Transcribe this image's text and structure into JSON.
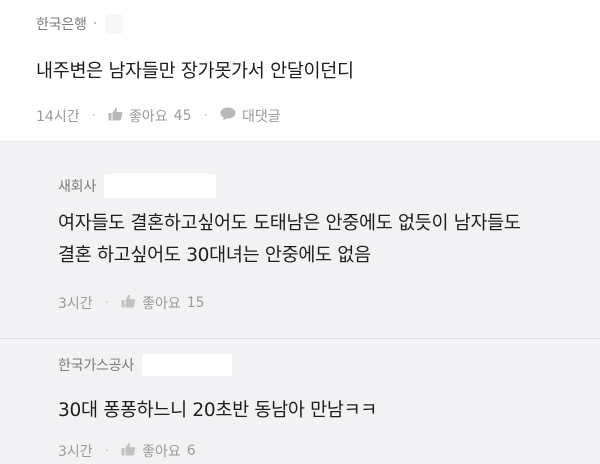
{
  "comments": [
    {
      "author": "한국은행",
      "text": "내주변은 남자들만 장가못가서 안달이던디",
      "time": "14시간",
      "like_label": "좋아요",
      "like_count": "45",
      "reply_label": "대댓글"
    },
    {
      "author": "새회사",
      "text_line1": "여자들도 결혼하고싶어도 도태남은 안중에도 없듯이 남자들도",
      "text_line2": "결혼 하고싶어도 30대녀는 안중에도 없음",
      "time": "3시간",
      "like_label": "좋아요",
      "like_count": "15"
    },
    {
      "author": "한국가스공사",
      "text": "30대 퐁퐁하느니 20초반 동남아 만남ㅋㅋ",
      "time": "3시간",
      "like_label": "좋아요",
      "like_count": "6"
    }
  ],
  "icons": {
    "like": "thumbs-up-icon",
    "reply": "speech-bubble-icon"
  }
}
